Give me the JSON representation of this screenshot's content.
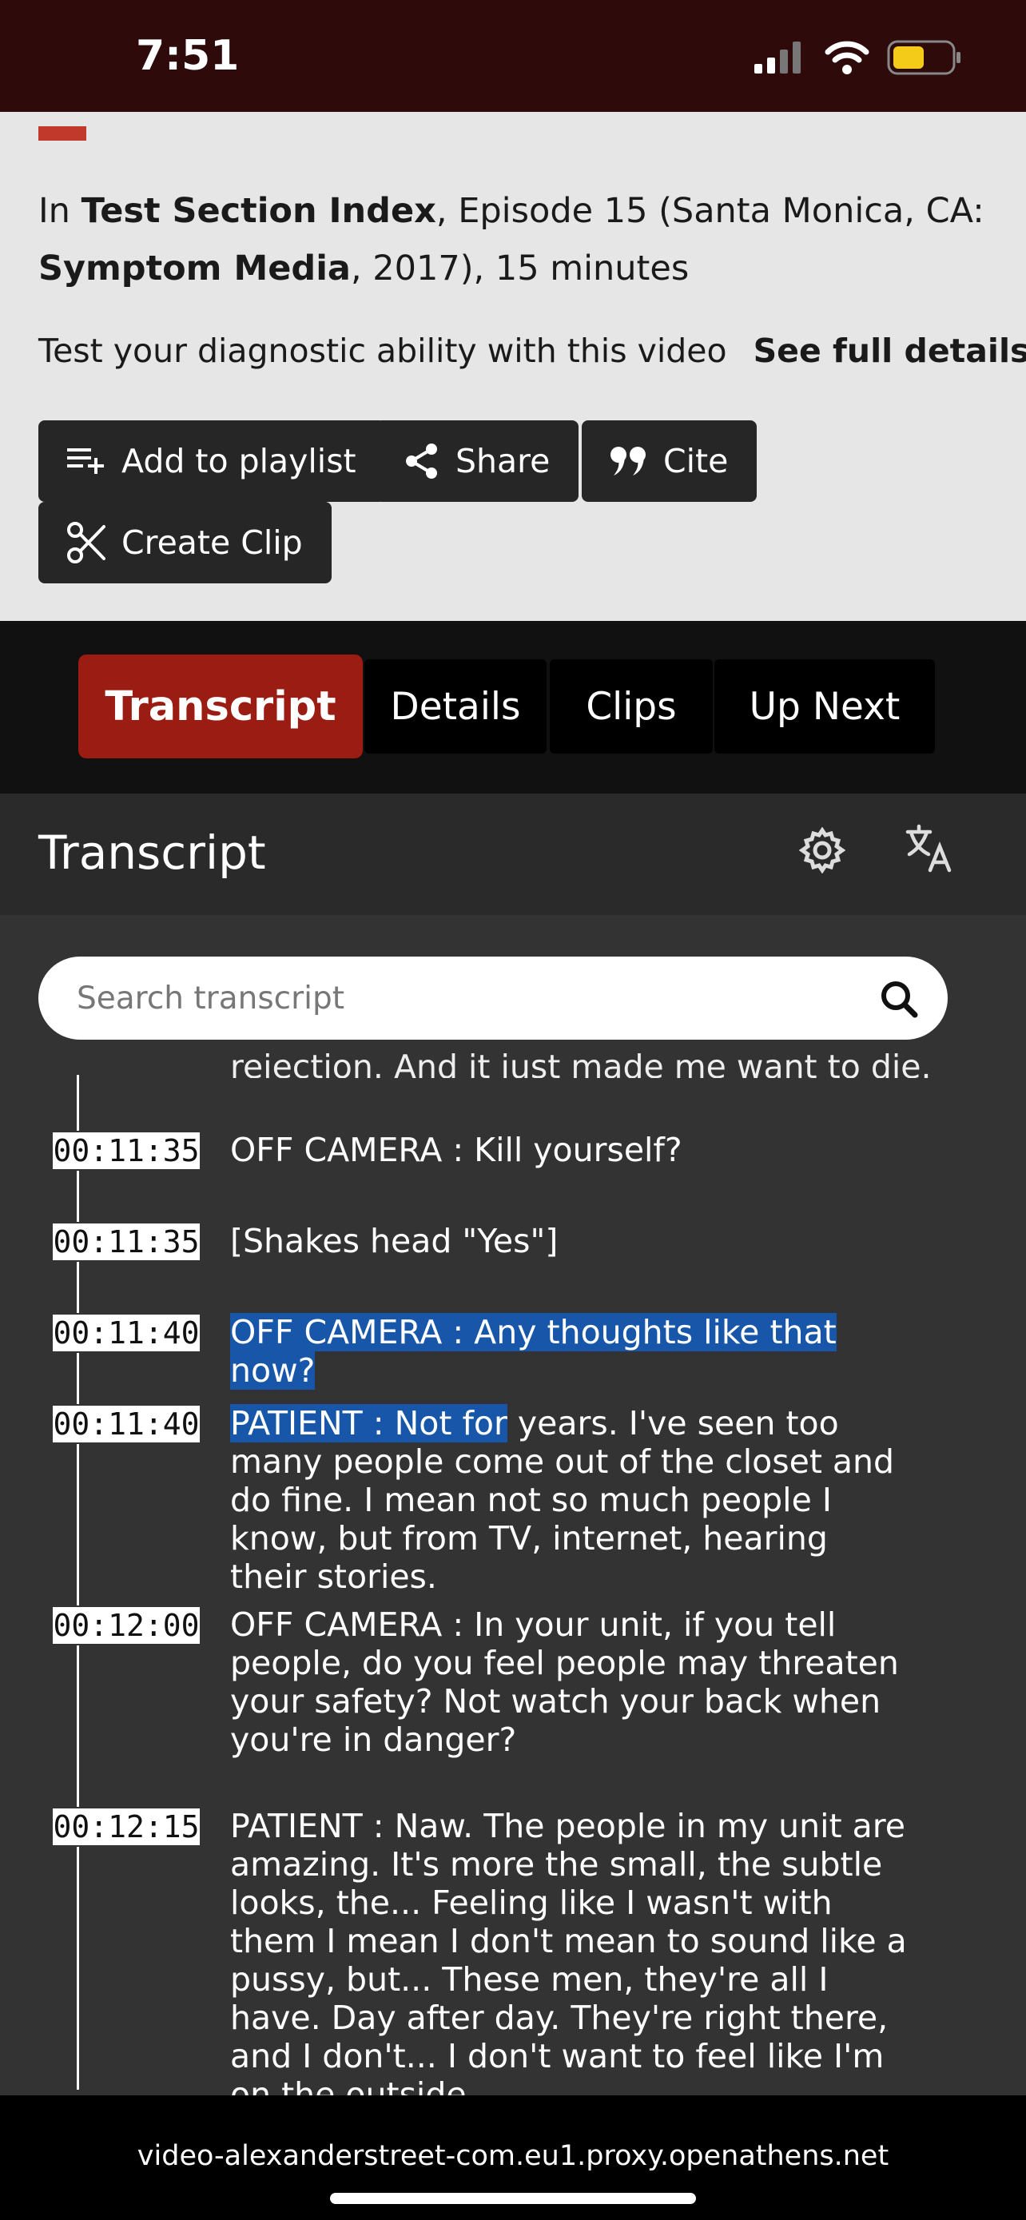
{
  "status_bar": {
    "time": "7:51"
  },
  "info": {
    "citation_prefix": "In ",
    "series_title": "Test Section Index",
    "citation_episode": ", Episode 15 (Santa Monica, CA: ",
    "publisher": "Symptom Media",
    "citation_suffix": ", 2017), 15 minutes",
    "description": "Test your diagnostic ability with this video",
    "see_full_details": "See full details",
    "buttons": {
      "add_to_playlist": "Add to playlist",
      "share": "Share",
      "cite": "Cite",
      "create_clip": "Create Clip"
    }
  },
  "tabs": [
    {
      "label": "Transcript",
      "active": true
    },
    {
      "label": "Details",
      "active": false
    },
    {
      "label": "Clips",
      "active": false
    },
    {
      "label": "Up Next",
      "active": false
    }
  ],
  "transcript": {
    "title": "Transcript",
    "search_placeholder": "Search transcript",
    "cut_off_line": "rejection. And it just made me want to die.",
    "entries": [
      {
        "time": "00:11:35",
        "text": "OFF CAMERA : Kill yourself?"
      },
      {
        "time": "00:11:35",
        "text": "[Shakes head \"Yes\"]"
      },
      {
        "time": "00:11:40",
        "highlight": "OFF CAMERA : Any thoughts like that now?",
        "text": ""
      },
      {
        "time": "00:11:40",
        "highlight": "PATIENT : Not for",
        "text": " years. I've seen too many people come out of the closet and do fine. I mean not so much people I know, but from TV, internet, hearing their stories."
      },
      {
        "time": "00:12:00",
        "text": "OFF CAMERA : In your unit, if you tell people, do you feel people may threaten your safety? Not watch your back when you're in danger?"
      },
      {
        "time": "00:12:15",
        "text": "PATIENT : Naw. The people in my unit are amazing. It's more the small, the subtle looks, the... Feeling like I wasn't with them I mean I don't mean to sound like a pussy, but... These men, they're all I have. Day after day. They're right there, and I don't... I don't want to feel like I'm on the outside."
      }
    ]
  },
  "browser": {
    "url": "video-alexanderstreet-com.eu1.proxy.openathens.net"
  },
  "colors": {
    "accent": "#9b1c13",
    "highlight": "#1756a8",
    "status_bar": "#2e0a0b"
  }
}
